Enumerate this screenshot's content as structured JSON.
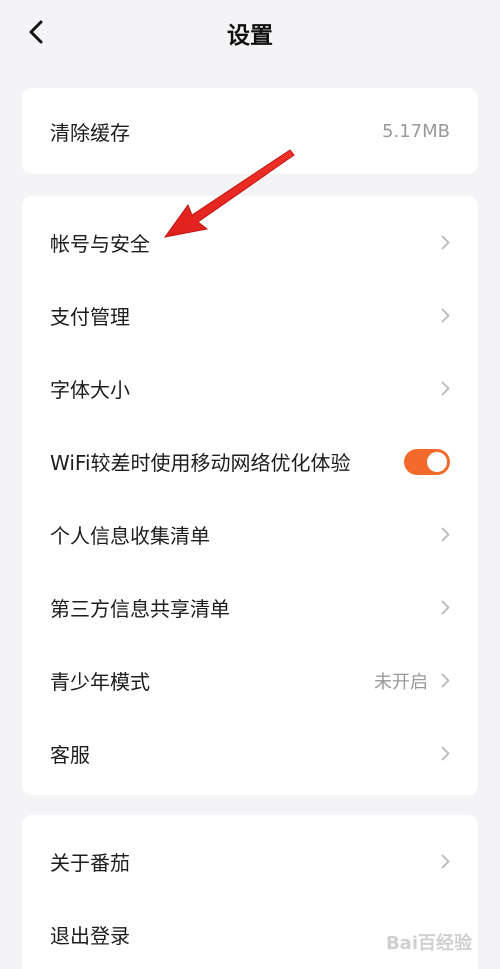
{
  "header": {
    "title": "设置"
  },
  "group1": {
    "items": [
      {
        "label": "清除缓存",
        "value": "5.17MB"
      }
    ]
  },
  "group2": {
    "items": [
      {
        "label": "帐号与安全"
      },
      {
        "label": "支付管理"
      },
      {
        "label": "字体大小"
      },
      {
        "label": "WiFi较差时使用移动网络优化体验",
        "toggle_on": true
      },
      {
        "label": "个人信息收集清单"
      },
      {
        "label": "第三方信息共享清单"
      },
      {
        "label": "青少年模式",
        "value": "未开启"
      },
      {
        "label": "客服"
      }
    ]
  },
  "group3": {
    "items": [
      {
        "label": "关于番茄"
      },
      {
        "label": "退出登录"
      }
    ]
  },
  "colors": {
    "accent": "#f26b2d",
    "arrow": "#e0201c",
    "background": "#f4f4f6"
  },
  "icons": {
    "back": "chevron-left-icon",
    "row": "chevron-right-icon"
  },
  "watermark": {
    "text": "Bai百经验"
  }
}
